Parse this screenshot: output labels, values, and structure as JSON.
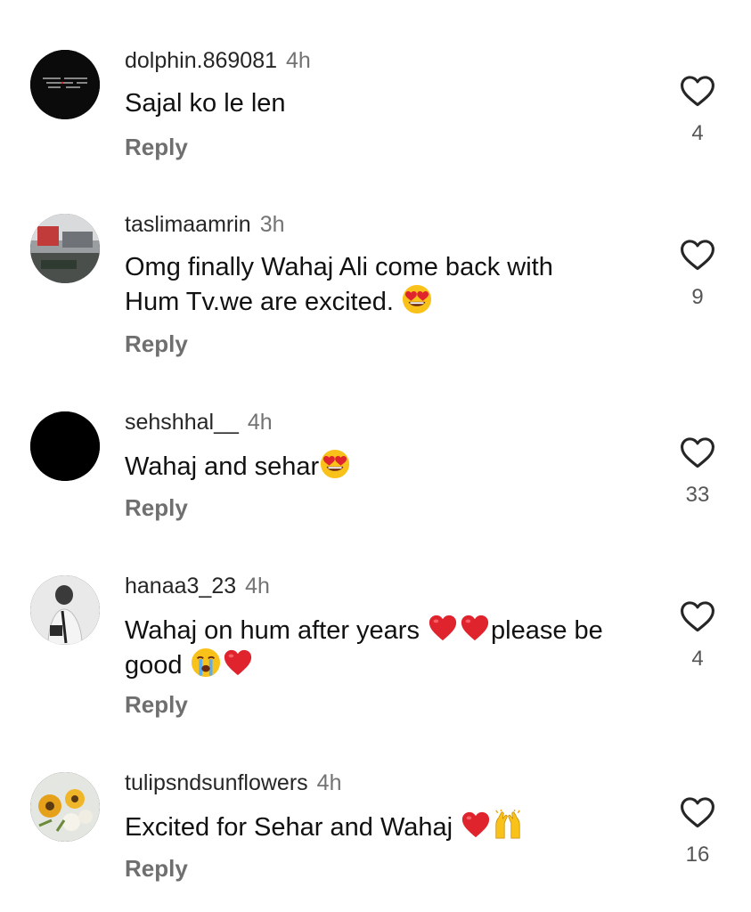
{
  "comments": [
    {
      "username": "dolphin.869081",
      "time": "4h",
      "text_parts": [
        "Sajal ko le len"
      ],
      "reply_label": "Reply",
      "likes": "4",
      "avatar": "dark-text-avatar"
    },
    {
      "username": "taslimaamrin",
      "time": "3h",
      "text_line1": "Omg finally Wahaj Ali come back with",
      "text_line2": "Hum Tv.we are excited.",
      "reply_label": "Reply",
      "likes": "9",
      "avatar": "photo-avatar"
    },
    {
      "username": "sehshhal__",
      "time": "4h",
      "text": "Wahaj and sehar",
      "reply_label": "Reply",
      "likes": "33",
      "avatar": "black-avatar"
    },
    {
      "username": "hanaa3_23",
      "time": "4h",
      "text_a": "Wahaj on hum after years",
      "text_b": "please be",
      "text_c": "good",
      "reply_label": "Reply",
      "likes": "4",
      "avatar": "bw-photo-avatar"
    },
    {
      "username": "tulipsndsunflowers",
      "time": "4h",
      "text": "Excited for Sehar and Wahaj",
      "reply_label": "Reply",
      "likes": "16",
      "avatar": "sunflower-avatar"
    }
  ],
  "icons": {
    "like": "heart-outline-icon",
    "emojis": [
      "heart-eyes-emoji",
      "red-heart-emoji",
      "crying-face-emoji",
      "raised-hands-emoji"
    ]
  },
  "colors": {
    "username": "#262626",
    "timestamp": "#737373",
    "reply": "#6f6f6f",
    "heart_emoji": "#e0242e",
    "emoji_yellow": "#f9c21b"
  }
}
